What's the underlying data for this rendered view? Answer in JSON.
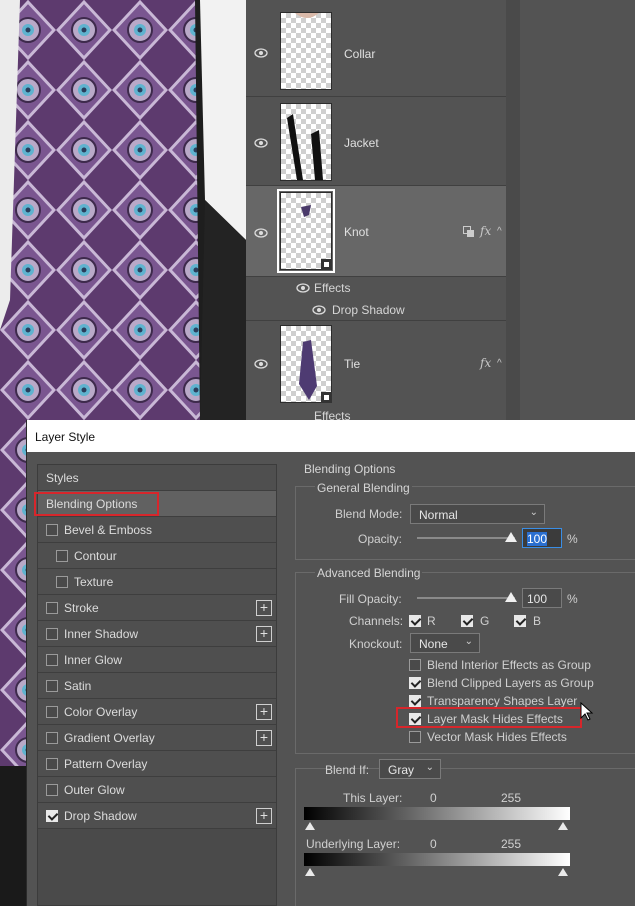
{
  "layers_panel": {
    "layers": [
      {
        "name": "Collar",
        "has_fx": false
      },
      {
        "name": "Jacket",
        "has_fx": false
      },
      {
        "name": "Knot",
        "has_fx": true
      },
      {
        "name": "Tie",
        "has_fx": true
      }
    ],
    "effects_label": "Effects",
    "drop_shadow_label": "Drop Shadow",
    "tie_effects_label": "Effects",
    "fx_glyph": "fx"
  },
  "dialog": {
    "title": "Layer Style",
    "styles": [
      {
        "label": "Styles",
        "type": "header"
      },
      {
        "label": "Blending Options",
        "type": "active"
      },
      {
        "label": "Bevel & Emboss",
        "checked": false
      },
      {
        "label": "Contour",
        "checked": false,
        "indent": true
      },
      {
        "label": "Texture",
        "checked": false,
        "indent": true
      },
      {
        "label": "Stroke",
        "checked": false,
        "plus": true
      },
      {
        "label": "Inner Shadow",
        "checked": false,
        "plus": true
      },
      {
        "label": "Inner Glow",
        "checked": false
      },
      {
        "label": "Satin",
        "checked": false
      },
      {
        "label": "Color Overlay",
        "checked": false,
        "plus": true
      },
      {
        "label": "Gradient Overlay",
        "checked": false,
        "plus": true
      },
      {
        "label": "Pattern Overlay",
        "checked": false
      },
      {
        "label": "Outer Glow",
        "checked": false
      },
      {
        "label": "Drop Shadow",
        "checked": true,
        "plus": true
      }
    ],
    "blending": {
      "section_title": "Blending Options",
      "general_title": "General Blending",
      "blend_mode_label": "Blend Mode:",
      "blend_mode_value": "Normal",
      "opacity_label": "Opacity:",
      "opacity_value": "100",
      "percent": "%",
      "advanced_title": "Advanced Blending",
      "fill_opacity_label": "Fill Opacity:",
      "fill_opacity_value": "100",
      "channels_label": "Channels:",
      "channel_r": "R",
      "channel_g": "G",
      "channel_b": "B",
      "knockout_label": "Knockout:",
      "knockout_value": "None",
      "options": [
        {
          "label": "Blend Interior Effects as Group",
          "checked": false
        },
        {
          "label": "Blend Clipped Layers as Group",
          "checked": true
        },
        {
          "label": "Transparency Shapes Layer",
          "checked": true
        },
        {
          "label": "Layer Mask Hides Effects",
          "checked": true
        },
        {
          "label": "Vector Mask Hides Effects",
          "checked": false
        }
      ],
      "blend_if_label": "Blend If:",
      "blend_if_value": "Gray",
      "this_layer_label": "This Layer:",
      "this_layer_min": "0",
      "this_layer_max": "255",
      "underlying_label": "Underlying Layer:",
      "underlying_min": "0",
      "underlying_max": "255"
    }
  }
}
